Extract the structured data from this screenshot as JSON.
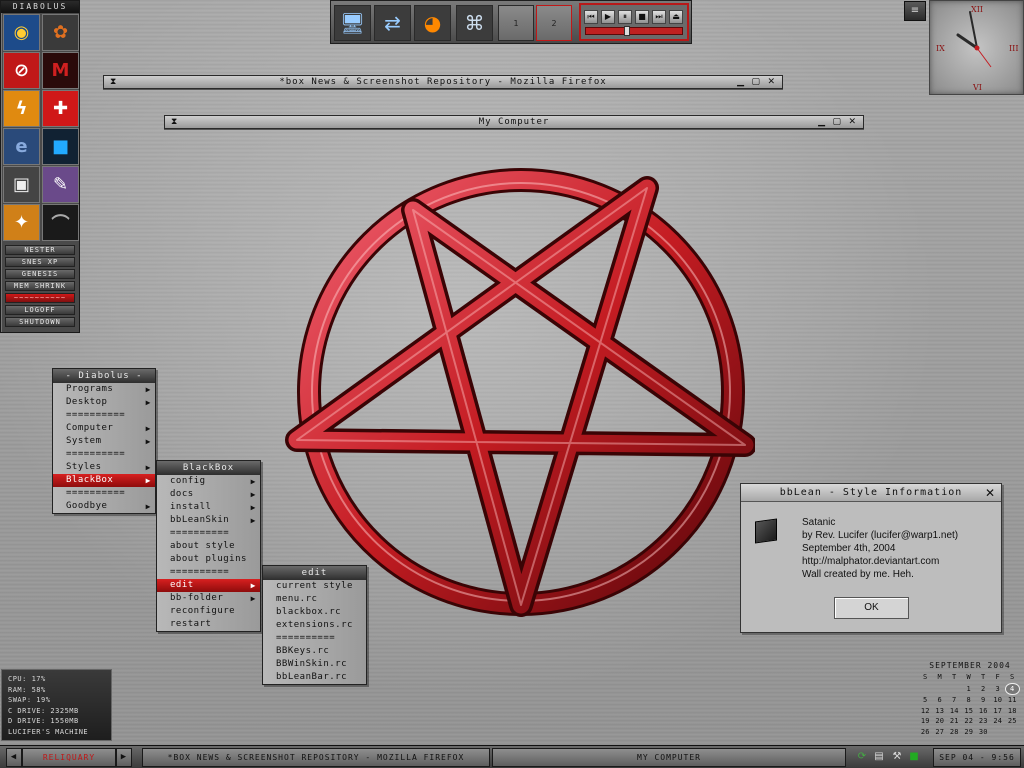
{
  "left_panel": {
    "title": "DIABOLUS",
    "icons": [
      "winamp-icon",
      "paint-palette-icon",
      "irc-icon",
      "m-logo-icon",
      "lightning-icon",
      "swiss-knife-icon",
      "ie-icon",
      "square-icon",
      "computer-icon",
      "pen-icon",
      "game-icon",
      "arc-icon"
    ],
    "buttons": [
      "NESTER",
      "SNES XP",
      "GENESIS",
      "MEM SHRINK",
      "~~~~~~~~~~",
      "LOGOFF",
      "SHUTDOWN"
    ]
  },
  "top_bar": {
    "icons": [
      "computer-icon",
      "network-icon",
      "firefox-icon",
      "bat-icon"
    ],
    "workspaces": [
      "1",
      "2"
    ],
    "media_buttons": [
      "prev-icon",
      "play-icon",
      "pause-icon",
      "stop-icon",
      "next-icon",
      "eject-icon"
    ],
    "seek_position_pct": 40
  },
  "mini_button_label": "≡",
  "clock": {
    "numerals": [
      "XII",
      "III",
      "VI",
      "IX"
    ],
    "time": "9:56"
  },
  "windows": [
    {
      "title": "*box News & Screenshot Repository - Mozilla Firefox"
    },
    {
      "title": "My Computer"
    }
  ],
  "menus": {
    "main": {
      "title": "- Diabolus -",
      "items": [
        {
          "label": "Programs",
          "arrow": "▶"
        },
        {
          "label": "Desktop",
          "arrow": "▶"
        },
        {
          "label": "==========",
          "arrow": ""
        },
        {
          "label": "Computer",
          "arrow": "▶"
        },
        {
          "label": "System",
          "arrow": "▶"
        },
        {
          "label": "==========",
          "arrow": ""
        },
        {
          "label": "Styles",
          "arrow": "▶"
        },
        {
          "label": "BlackBox",
          "arrow": "▶"
        },
        {
          "label": "==========",
          "arrow": ""
        },
        {
          "label": "Goodbye",
          "arrow": "▶"
        }
      ]
    },
    "blackbox": {
      "title": "BlackBox",
      "items": [
        {
          "label": "config",
          "arrow": "▶"
        },
        {
          "label": "docs",
          "arrow": "▶"
        },
        {
          "label": "install",
          "arrow": "▶"
        },
        {
          "label": "bbLeanSkin",
          "arrow": "▶"
        },
        {
          "label": "==========",
          "arrow": ""
        },
        {
          "label": "about style",
          "arrow": ""
        },
        {
          "label": "about plugins",
          "arrow": ""
        },
        {
          "label": "==========",
          "arrow": ""
        },
        {
          "label": "edit",
          "arrow": "▶"
        },
        {
          "label": "bb-folder",
          "arrow": "▶"
        },
        {
          "label": "reconfigure",
          "arrow": ""
        },
        {
          "label": "restart",
          "arrow": ""
        }
      ]
    },
    "edit": {
      "title": "edit",
      "items": [
        {
          "label": "current style",
          "arrow": ""
        },
        {
          "label": "menu.rc",
          "arrow": ""
        },
        {
          "label": "blackbox.rc",
          "arrow": ""
        },
        {
          "label": "extensions.rc",
          "arrow": ""
        },
        {
          "label": "==========",
          "arrow": ""
        },
        {
          "label": "BBKeys.rc",
          "arrow": ""
        },
        {
          "label": "BBWinSkin.rc",
          "arrow": ""
        },
        {
          "label": "bbLeanBar.rc",
          "arrow": ""
        }
      ]
    }
  },
  "style_info": {
    "title": "bbLean - Style Information",
    "lines": [
      "Satanic",
      "by Rev. Lucifer (lucifer@warp1.net)",
      "September 4th, 2004",
      "http://malphator.deviantart.com",
      "Wall created by me. Heh."
    ],
    "ok_label": "OK"
  },
  "sysmon": {
    "rows": [
      "CPU: 17%",
      "RAM: 58%",
      "SWAP: 19%",
      "C DRIVE: 2325MB",
      "D DRIVE: 1550MB",
      "LUCIFER'S MACHINE"
    ]
  },
  "calendar": {
    "title": "SEPTEMBER 2004",
    "header": [
      "S",
      "M",
      "T",
      "W",
      "T",
      "F",
      "S"
    ],
    "weeks": [
      [
        "",
        "",
        "",
        "1",
        "2",
        "3",
        "4"
      ],
      [
        "5",
        "6",
        "7",
        "8",
        "9",
        "10",
        "11"
      ],
      [
        "12",
        "13",
        "14",
        "15",
        "16",
        "17",
        "18"
      ],
      [
        "19",
        "20",
        "21",
        "22",
        "23",
        "24",
        "25"
      ],
      [
        "26",
        "27",
        "28",
        "29",
        "30",
        "",
        ""
      ]
    ],
    "today": "4"
  },
  "taskbar": {
    "workspace_label": "RELIQUARY",
    "tasks": [
      "*BOX NEWS & SCREENSHOT REPOSITORY - MOZILLA FIREFOX",
      "MY COMPUTER"
    ],
    "clock": "SEP 04 - 9:56"
  },
  "colors": {
    "accent": "#c41c22",
    "metal": "#a8a8a8"
  }
}
